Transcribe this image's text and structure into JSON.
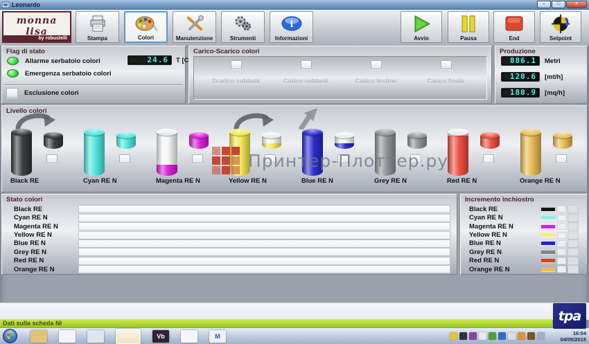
{
  "window": {
    "title": "Leonardo",
    "minimize_glyph": "–",
    "maximize_glyph": "□",
    "close_glyph": "×"
  },
  "brand": {
    "name": "monna lisa",
    "by": "by robustelli"
  },
  "toolbar": {
    "buttons": [
      {
        "label": "Stampa",
        "icon": "printer-icon",
        "active": false
      },
      {
        "label": "Colori",
        "icon": "palette-icon",
        "active": true
      },
      {
        "label": "Manutenzione",
        "icon": "tools-icon",
        "active": false
      },
      {
        "label": "Strumenti",
        "icon": "gears-icon",
        "active": false
      },
      {
        "label": "Informazioni",
        "icon": "info-icon",
        "active": false
      }
    ],
    "actions": [
      {
        "label": "Avvio",
        "icon": "play-icon"
      },
      {
        "label": "Pausa",
        "icon": "pause-icon"
      },
      {
        "label": "End",
        "icon": "stop-icon"
      },
      {
        "label": "Setpoint",
        "icon": "setpoint-icon"
      }
    ]
  },
  "flag_di_stato": {
    "title": "Flag di stato",
    "alarm_label": "Allarme serbatoio colori",
    "temperature_value": "24.6",
    "temperature_unit": "T [C°]",
    "emergency_label": "Emergenza serbatoio colori",
    "exclusion_label": "Esclusione colori"
  },
  "carico_scarico": {
    "title": "Carico-Scarico colori",
    "options": [
      "Scarico subtank",
      "Carico subtank",
      "Carico testine",
      "Carico finale"
    ]
  },
  "produzione": {
    "title": "Produzione",
    "metrics": [
      {
        "value": "886.1",
        "unit": "Metri"
      },
      {
        "value": "120.6",
        "unit": "[mt/h]"
      },
      {
        "value": "180.9",
        "unit": "[mq/h]"
      }
    ]
  },
  "livello_colori": {
    "title": "Livello colori",
    "colors": [
      {
        "name": "Black RE",
        "hex": "#333436",
        "tank_level": 100,
        "subtank_level": 100,
        "arrow": "curve"
      },
      {
        "name": "Cyan RE N",
        "hex": "#49e6de",
        "tank_level": 100,
        "subtank_level": 100,
        "arrow": "none"
      },
      {
        "name": "Magenta RE N",
        "hex": "#d816d8",
        "tank_level": 26,
        "subtank_level": 100,
        "arrow": "none"
      },
      {
        "name": "Yellow RE N",
        "hex": "#f0e84e",
        "tank_level": 100,
        "subtank_level": 42,
        "arrow": "curve"
      },
      {
        "name": "Blue RE N",
        "hex": "#2424cd",
        "tank_level": 100,
        "subtank_level": 38,
        "arrow": "up"
      },
      {
        "name": "Grey RE N",
        "hex": "#8e9094",
        "tank_level": 100,
        "subtank_level": 100,
        "arrow": "none"
      },
      {
        "name": "Red RE N",
        "hex": "#ec4a38",
        "tank_level": 92,
        "subtank_level": 100,
        "arrow": "none"
      },
      {
        "name": "Orange RE N",
        "hex": "#e7b94e",
        "tank_level": 100,
        "subtank_level": 100,
        "arrow": "none"
      }
    ]
  },
  "stato_colori": {
    "title": "Stato colori",
    "rows": [
      "Black RE",
      "Cyan RE N",
      "Magenta RE N",
      "Yellow RE N",
      "Blue RE N",
      "Grey RE N",
      "Red RE N",
      "Orange RE N"
    ]
  },
  "incremento_inchiostro": {
    "title": "Incremento inchiostro",
    "rows": [
      {
        "name": "Black RE",
        "hex": "#141414"
      },
      {
        "name": "Cyan RE N",
        "hex": "#8af0e8"
      },
      {
        "name": "Magenta RE N",
        "hex": "#e01ae0"
      },
      {
        "name": "Yellow RE N",
        "hex": "#f6ef6e"
      },
      {
        "name": "Blue RE N",
        "hex": "#2222cc"
      },
      {
        "name": "Grey RE N",
        "hex": "#808388"
      },
      {
        "name": "Red RE N",
        "hex": "#e23a1a"
      },
      {
        "name": "Orange RE N",
        "hex": "#f2bc44"
      }
    ]
  },
  "status_bar": {
    "text": "Dati sulla scheda NI"
  },
  "watermark": {
    "text": "Принтер-Плоттер.ру"
  },
  "tpa_logo": "tpa",
  "taskbar": {
    "time": "16:04",
    "date": "04/05/2015",
    "apps": [
      {
        "name": "folder-icon",
        "color": "#e3c27c",
        "glyph": ""
      },
      {
        "name": "chart-icon",
        "color": "#f3f5f7",
        "glyph": ""
      },
      {
        "name": "document-icon",
        "color": "#dfe6ee",
        "glyph": ""
      },
      {
        "name": "leonardo-form-icon",
        "color": "#ecdfb6",
        "glyph": "",
        "active": true
      },
      {
        "name": "vb-icon",
        "color": "#2f2436",
        "glyph": "Vb",
        "glyph_color": "#ffffff"
      },
      {
        "name": "pen-icon",
        "color": "#f4f6f8",
        "glyph": ""
      },
      {
        "name": "m-icon",
        "color": "#eef1f5",
        "glyph": "M",
        "glyph_color": "#2a4ac0"
      }
    ],
    "tray": [
      {
        "name": "shield-icon",
        "color": "#e6c33c"
      },
      {
        "name": "network-icon",
        "color": "#2f3338"
      },
      {
        "name": "vb-tray-icon",
        "color": "#86489a"
      },
      {
        "name": "window-tray-icon",
        "color": "#e7e9ec"
      },
      {
        "name": "green-status-icon",
        "color": "#49a23c"
      },
      {
        "name": "blue-app-icon",
        "color": "#3a68ca"
      },
      {
        "name": "white-app-icon",
        "color": "#dadee4"
      },
      {
        "name": "orange-arrow-icon",
        "color": "#e2913a"
      },
      {
        "name": "package-icon",
        "color": "#77571e"
      },
      {
        "name": "update-icon",
        "color": "#9fb0c6"
      }
    ]
  }
}
